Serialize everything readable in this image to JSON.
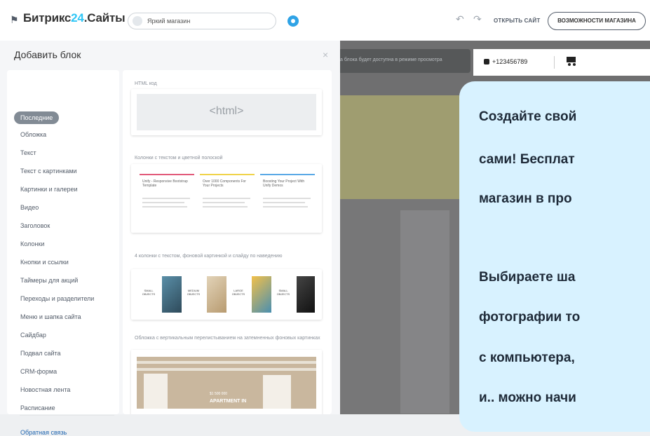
{
  "header": {
    "logo_name": "Битрикс",
    "logo_number": "24",
    "logo_suffix": ".Сайты",
    "site_name": "Яркий магазин",
    "open_site": "ОТКРЫТЬ САЙТ",
    "store_features": "ВОЗМОЖНОСТИ МАГАЗИНА"
  },
  "panel": {
    "title": "Добавить блок",
    "close": "×",
    "categories": [
      "Последние",
      "Обложка",
      "Текст",
      "Текст с картинками",
      "Картинки и галереи",
      "Видео",
      "Заголовок",
      "Колонки",
      "Кнопки и ссылки",
      "Таймеры для акций",
      "Переходы и разделители",
      "Меню и шапка сайта",
      "Сайдбар",
      "Подвал сайта",
      "CRM-форма",
      "Новостная лента",
      "Расписание"
    ],
    "active_category": "Последние",
    "feedback": "Обратная связь",
    "blocks": [
      {
        "title": "HTML код",
        "preview_text": "<html>"
      },
      {
        "title": "Колонки с текстом и цветной полоской",
        "columns": [
          "Unify - Responsive Bootstrap Template",
          "Over 1000 Components For Your Projects",
          "Boosting Your Project With Unify Demos"
        ]
      },
      {
        "title": "4 колонки с текстом, фоновой картинкой и слайду по наведению",
        "labels": [
          "SMALL OBJECTS",
          "MEDIUM OBJECTS",
          "LARGE OBJECTS",
          "SMALL OBJECTS"
        ]
      },
      {
        "title": "Обложка с вертикальным перелистыванием на затемненных фоновых картинках",
        "price": "$1 500 000",
        "heading": "APARTMENT IN"
      }
    ]
  },
  "preview": {
    "notice": "а блока будет доступна в режиме просмотра",
    "phone": "+123456789"
  },
  "callout": {
    "lines": [
      "Создайте свой",
      "сами! Бесплат",
      "магазин в про",
      "",
      "Выбираете ша",
      "фотографии то",
      "с компьютера,",
      "и.. можно начи"
    ]
  },
  "colors": {
    "accent": "#2fc6f6",
    "callout_bg": "#d8f2ff",
    "active_chip": "#828b95"
  }
}
